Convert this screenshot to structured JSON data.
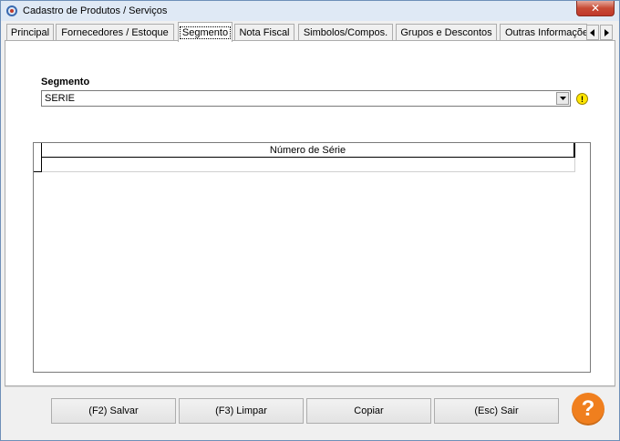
{
  "window": {
    "title": "Cadastro de Produtos / Serviços",
    "close_glyph": "✕"
  },
  "tabs": [
    {
      "label": "Principal"
    },
    {
      "label": "Fornecedores / Estoque"
    },
    {
      "label": "Segmento"
    },
    {
      "label": "Nota Fiscal"
    },
    {
      "label": "Simbolos/Compos."
    },
    {
      "label": "Grupos e Descontos"
    },
    {
      "label": "Outras Informações"
    }
  ],
  "active_tab": "Segmento",
  "tab_scroll": {
    "left_icon": "arrow-left-icon",
    "right_icon": "arrow-right-icon"
  },
  "segmento": {
    "label": "Segmento",
    "value": "SERIE",
    "warning_glyph": "!"
  },
  "grid": {
    "columns": [
      "Número de Série"
    ],
    "rows": [
      [
        ""
      ]
    ]
  },
  "buttons": {
    "save": "(F2) Salvar",
    "clear": "(F3) Limpar",
    "copy": "Copiar",
    "exit": "(Esc) Sair",
    "help_glyph": "?"
  },
  "colors": {
    "help_button": "#f07f1e",
    "warning_icon": "#ffe600",
    "close_button": "#c74a35"
  }
}
